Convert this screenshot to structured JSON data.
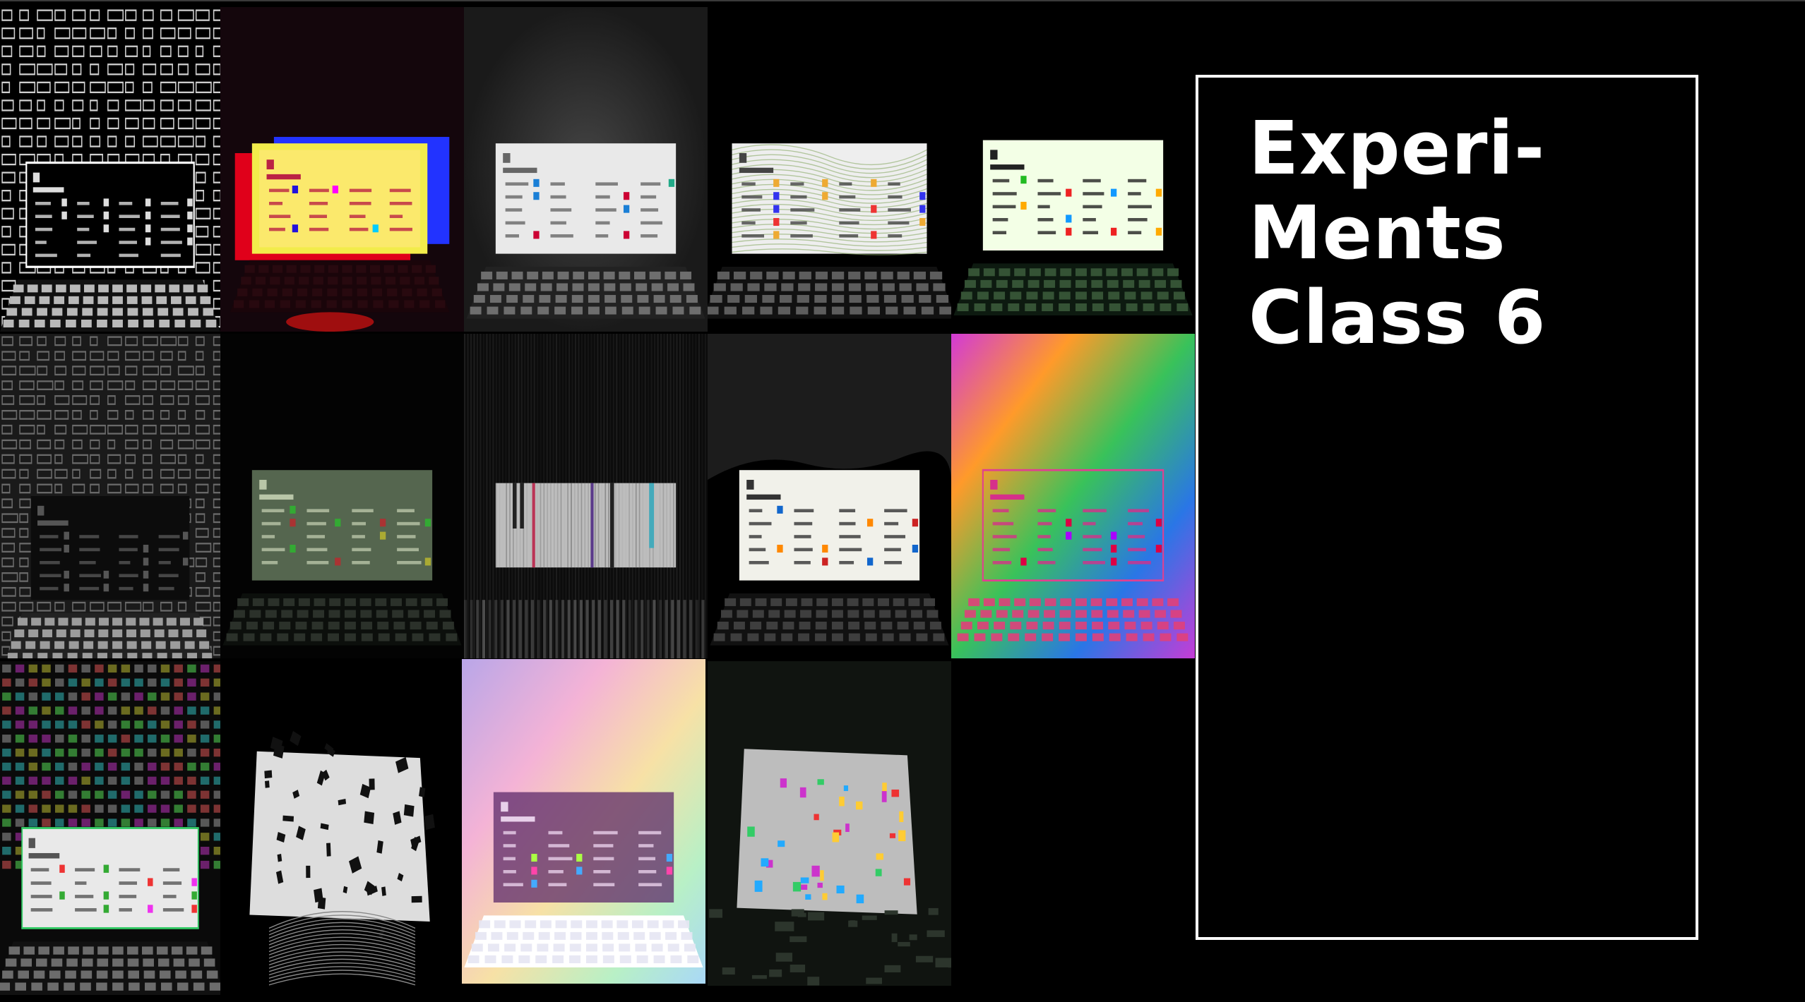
{
  "slide": {
    "title_lines": [
      "Experi-",
      "Ments",
      "Class 6"
    ]
  },
  "colors": {
    "background": "#000000",
    "frame": "#ffffff",
    "title": "#ffffff"
  },
  "tiles": [
    {
      "name": "experiment-tile-outline-pattern",
      "variant": "outline-pattern"
    },
    {
      "name": "experiment-tile-rgb-split",
      "variant": "rgb-split"
    },
    {
      "name": "experiment-tile-glow-dark",
      "variant": "glow-dark"
    },
    {
      "name": "experiment-tile-wave-distort",
      "variant": "wave-distort"
    },
    {
      "name": "experiment-tile-bright-screen",
      "variant": "bright-screen"
    },
    {
      "name": "experiment-tile-gray-pattern",
      "variant": "gray-pattern"
    },
    {
      "name": "experiment-tile-green-dim",
      "variant": "green-dim"
    },
    {
      "name": "experiment-tile-vertical-stripes",
      "variant": "vertical-stripes"
    },
    {
      "name": "experiment-tile-posterized",
      "variant": "posterized"
    },
    {
      "name": "experiment-tile-rainbow-gradient",
      "variant": "rainbow-gradient"
    },
    {
      "name": "experiment-tile-chromatic-pattern",
      "variant": "chromatic-pattern"
    },
    {
      "name": "experiment-tile-white-scatter",
      "variant": "white-scatter"
    },
    {
      "name": "experiment-tile-pastel-gradient",
      "variant": "pastel-gradient"
    },
    {
      "name": "experiment-tile-glitch-scatter",
      "variant": "glitch-scatter"
    }
  ]
}
